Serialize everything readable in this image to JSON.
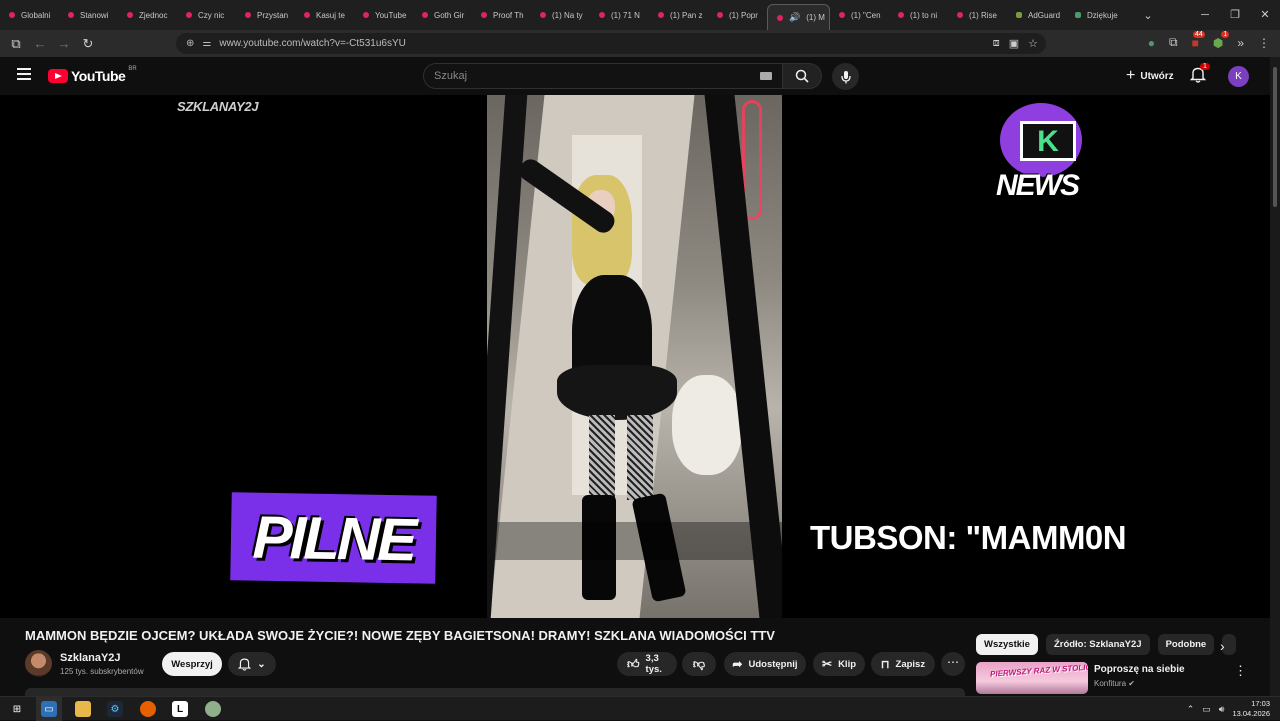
{
  "browser": {
    "tabs": [
      {
        "label": "Globalni",
        "icon": "youtube-icon"
      },
      {
        "label": "Stanowi",
        "icon": "youtube-icon"
      },
      {
        "label": "Zjednoc",
        "icon": "youtube-icon"
      },
      {
        "label": "Czy nic",
        "icon": "youtube-icon"
      },
      {
        "label": "Przystan",
        "icon": "youtube-icon"
      },
      {
        "label": "Kasuj te",
        "icon": "youtube-icon"
      },
      {
        "label": "YouTube",
        "icon": "youtube-icon"
      },
      {
        "label": "Goth Gir",
        "icon": "youtube-icon"
      },
      {
        "label": "Proof Th",
        "icon": "youtube-icon"
      },
      {
        "label": "(1) Na ty",
        "icon": "youtube-icon"
      },
      {
        "label": "(1) 71 N",
        "icon": "youtube-icon"
      },
      {
        "label": "(1) Pan z",
        "icon": "youtube-icon"
      },
      {
        "label": "(1) Popr",
        "icon": "youtube-icon"
      },
      {
        "label": "(1) M",
        "icon": "youtube-icon",
        "active": true
      },
      {
        "label": "(1) \"Cen",
        "icon": "youtube-icon"
      },
      {
        "label": "(1) to ni",
        "icon": "youtube-icon"
      },
      {
        "label": "(1) Rise",
        "icon": "youtube-icon"
      },
      {
        "label": "AdGuard",
        "icon": "adguard-icon"
      },
      {
        "label": "Dziękuje",
        "icon": "shield-icon"
      }
    ],
    "url": "www.youtube.com/watch?v=-Ct531u6sYU",
    "ext_badge_1": "44",
    "ext_badge_2": "1"
  },
  "youtube": {
    "logo_word": "YouTube",
    "country_code": "BR",
    "search_placeholder": "Szukaj",
    "create_label": "Utwórz",
    "notif_count": "1",
    "avatar_letter": "K",
    "accent": "#ff0033"
  },
  "video": {
    "watermark_left": "SZKLANAY2J",
    "news_logo_word": "NEWS",
    "pilne": "PILNE",
    "tubson": "TUBSON: \"MAMM0N",
    "title": "MAMMON BĘDZIE OJCEM? UKŁADA SWOJE ŻYCIE?! NOWE ZĘBY BAGIETSONA! DRAMY! SZKLANA WIADOMOŚCI TTV",
    "channel_name": "SzklanaY2J",
    "subscribers": "125 tys. subskrybentów",
    "support_label": "Wesprzyj",
    "likes": "3,3 tys.",
    "share_label": "Udostępnij",
    "clip_label": "Klip",
    "save_label": "Zapisz"
  },
  "sidebar": {
    "chips": [
      "Wszystkie",
      "Źródło: SzklanaY2J",
      "Podobne"
    ],
    "suggestion": {
      "title": "Poproszę na siebie",
      "channel": "Konfitura",
      "thumb_text": "PIERWSZY RAZ W STOLICY"
    }
  },
  "taskbar": {
    "time": "17:03",
    "date": "13.04.2026"
  }
}
